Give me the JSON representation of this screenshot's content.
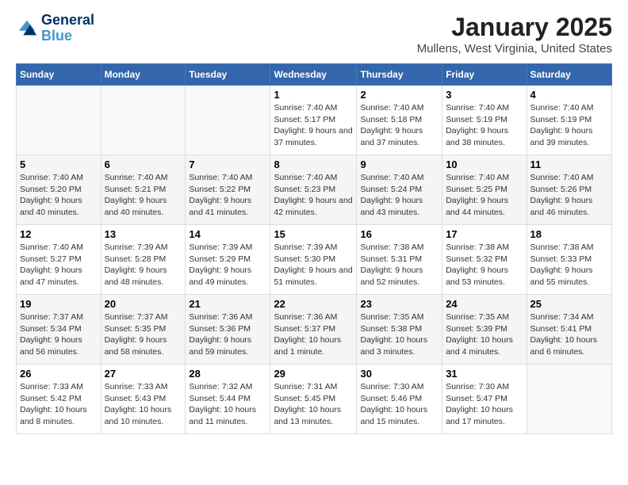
{
  "logo": {
    "line1": "General",
    "line2": "Blue"
  },
  "title": "January 2025",
  "subtitle": "Mullens, West Virginia, United States",
  "days_of_week": [
    "Sunday",
    "Monday",
    "Tuesday",
    "Wednesday",
    "Thursday",
    "Friday",
    "Saturday"
  ],
  "weeks": [
    [
      {
        "day": "",
        "info": ""
      },
      {
        "day": "",
        "info": ""
      },
      {
        "day": "",
        "info": ""
      },
      {
        "day": "1",
        "info": "Sunrise: 7:40 AM\nSunset: 5:17 PM\nDaylight: 9 hours and 37 minutes."
      },
      {
        "day": "2",
        "info": "Sunrise: 7:40 AM\nSunset: 5:18 PM\nDaylight: 9 hours and 37 minutes."
      },
      {
        "day": "3",
        "info": "Sunrise: 7:40 AM\nSunset: 5:19 PM\nDaylight: 9 hours and 38 minutes."
      },
      {
        "day": "4",
        "info": "Sunrise: 7:40 AM\nSunset: 5:19 PM\nDaylight: 9 hours and 39 minutes."
      }
    ],
    [
      {
        "day": "5",
        "info": "Sunrise: 7:40 AM\nSunset: 5:20 PM\nDaylight: 9 hours and 40 minutes."
      },
      {
        "day": "6",
        "info": "Sunrise: 7:40 AM\nSunset: 5:21 PM\nDaylight: 9 hours and 40 minutes."
      },
      {
        "day": "7",
        "info": "Sunrise: 7:40 AM\nSunset: 5:22 PM\nDaylight: 9 hours and 41 minutes."
      },
      {
        "day": "8",
        "info": "Sunrise: 7:40 AM\nSunset: 5:23 PM\nDaylight: 9 hours and 42 minutes."
      },
      {
        "day": "9",
        "info": "Sunrise: 7:40 AM\nSunset: 5:24 PM\nDaylight: 9 hours and 43 minutes."
      },
      {
        "day": "10",
        "info": "Sunrise: 7:40 AM\nSunset: 5:25 PM\nDaylight: 9 hours and 44 minutes."
      },
      {
        "day": "11",
        "info": "Sunrise: 7:40 AM\nSunset: 5:26 PM\nDaylight: 9 hours and 46 minutes."
      }
    ],
    [
      {
        "day": "12",
        "info": "Sunrise: 7:40 AM\nSunset: 5:27 PM\nDaylight: 9 hours and 47 minutes."
      },
      {
        "day": "13",
        "info": "Sunrise: 7:39 AM\nSunset: 5:28 PM\nDaylight: 9 hours and 48 minutes."
      },
      {
        "day": "14",
        "info": "Sunrise: 7:39 AM\nSunset: 5:29 PM\nDaylight: 9 hours and 49 minutes."
      },
      {
        "day": "15",
        "info": "Sunrise: 7:39 AM\nSunset: 5:30 PM\nDaylight: 9 hours and 51 minutes."
      },
      {
        "day": "16",
        "info": "Sunrise: 7:38 AM\nSunset: 5:31 PM\nDaylight: 9 hours and 52 minutes."
      },
      {
        "day": "17",
        "info": "Sunrise: 7:38 AM\nSunset: 5:32 PM\nDaylight: 9 hours and 53 minutes."
      },
      {
        "day": "18",
        "info": "Sunrise: 7:38 AM\nSunset: 5:33 PM\nDaylight: 9 hours and 55 minutes."
      }
    ],
    [
      {
        "day": "19",
        "info": "Sunrise: 7:37 AM\nSunset: 5:34 PM\nDaylight: 9 hours and 56 minutes."
      },
      {
        "day": "20",
        "info": "Sunrise: 7:37 AM\nSunset: 5:35 PM\nDaylight: 9 hours and 58 minutes."
      },
      {
        "day": "21",
        "info": "Sunrise: 7:36 AM\nSunset: 5:36 PM\nDaylight: 9 hours and 59 minutes."
      },
      {
        "day": "22",
        "info": "Sunrise: 7:36 AM\nSunset: 5:37 PM\nDaylight: 10 hours and 1 minute."
      },
      {
        "day": "23",
        "info": "Sunrise: 7:35 AM\nSunset: 5:38 PM\nDaylight: 10 hours and 3 minutes."
      },
      {
        "day": "24",
        "info": "Sunrise: 7:35 AM\nSunset: 5:39 PM\nDaylight: 10 hours and 4 minutes."
      },
      {
        "day": "25",
        "info": "Sunrise: 7:34 AM\nSunset: 5:41 PM\nDaylight: 10 hours and 6 minutes."
      }
    ],
    [
      {
        "day": "26",
        "info": "Sunrise: 7:33 AM\nSunset: 5:42 PM\nDaylight: 10 hours and 8 minutes."
      },
      {
        "day": "27",
        "info": "Sunrise: 7:33 AM\nSunset: 5:43 PM\nDaylight: 10 hours and 10 minutes."
      },
      {
        "day": "28",
        "info": "Sunrise: 7:32 AM\nSunset: 5:44 PM\nDaylight: 10 hours and 11 minutes."
      },
      {
        "day": "29",
        "info": "Sunrise: 7:31 AM\nSunset: 5:45 PM\nDaylight: 10 hours and 13 minutes."
      },
      {
        "day": "30",
        "info": "Sunrise: 7:30 AM\nSunset: 5:46 PM\nDaylight: 10 hours and 15 minutes."
      },
      {
        "day": "31",
        "info": "Sunrise: 7:30 AM\nSunset: 5:47 PM\nDaylight: 10 hours and 17 minutes."
      },
      {
        "day": "",
        "info": ""
      }
    ]
  ]
}
